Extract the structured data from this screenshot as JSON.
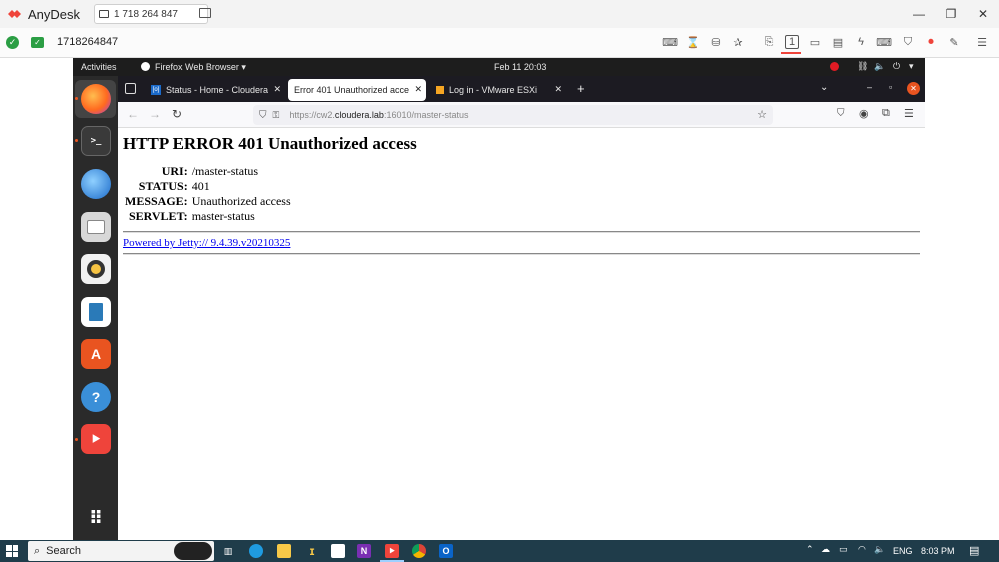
{
  "anydesk": {
    "app_name": "AnyDesk",
    "address": "1 718 264 847",
    "session_id": "1718264847"
  },
  "ubuntu": {
    "activities": "Activities",
    "app_menu": "Firefox Web Browser ▾",
    "clock": "Feb 11  20:03"
  },
  "firefox": {
    "tabs": [
      {
        "label": "Status - Home - Cloudera",
        "favicon": "cloudera-icon"
      },
      {
        "label": "Error 401 Unauthorized acce",
        "favicon": ""
      },
      {
        "label": "Log in - VMware ESXi",
        "favicon": "vmware-icon"
      }
    ],
    "new_tab": "+",
    "url_prefix": "https://cw2.",
    "url_host": "cloudera.lab",
    "url_suffix": ":16010/master-status"
  },
  "page": {
    "heading": "HTTP ERROR 401 Unauthorized access",
    "rows": [
      {
        "key": "URI:",
        "value": "/master-status"
      },
      {
        "key": "STATUS:",
        "value": "401"
      },
      {
        "key": "MESSAGE:",
        "value": "Unauthorized access"
      },
      {
        "key": "SERVLET:",
        "value": "master-status"
      }
    ],
    "footer_link": "Powered by Jetty:// 9.4.39.v20210325"
  },
  "taskbar": {
    "search_label": "Search",
    "language": "ENG",
    "time": "8:03 PM"
  },
  "colors": {
    "anydesk_red": "#ef443b",
    "ubuntu_orange": "#e95420",
    "taskbar": "#1f3c4a",
    "link": "#0000ee"
  }
}
